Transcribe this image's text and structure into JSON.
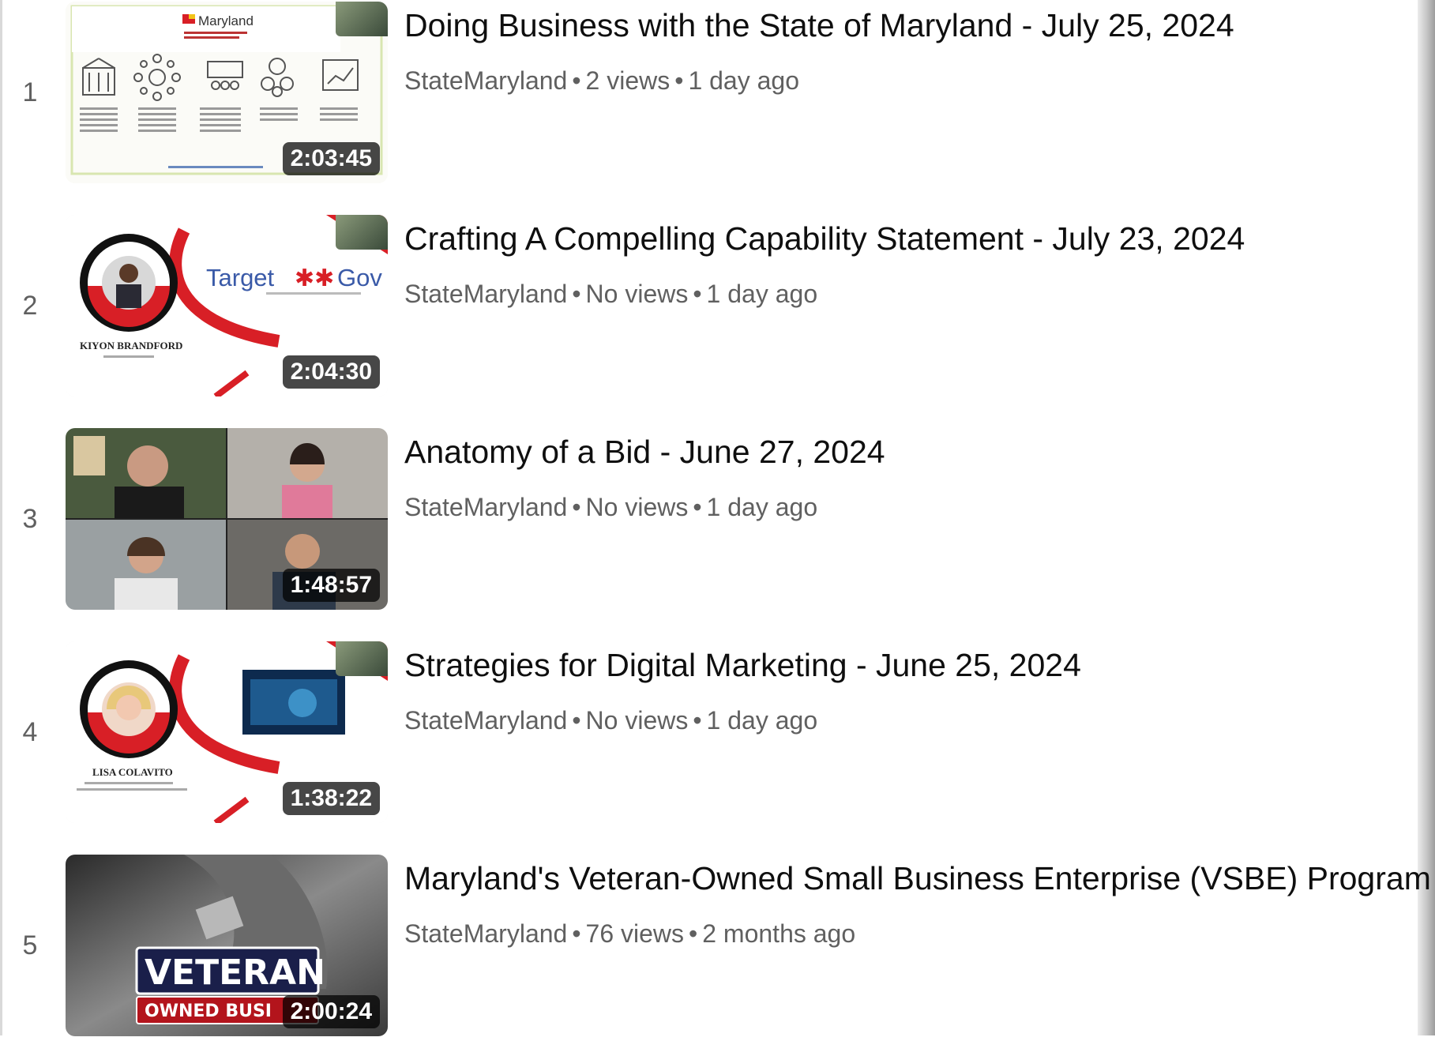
{
  "playlist": {
    "videos": [
      {
        "index": "1",
        "title": "Doing Business with the State of Maryland - July 25, 2024",
        "channel": "StateMaryland",
        "views": "2 views",
        "age": "1 day ago",
        "duration": "2:03:45",
        "thumb_logo": "Maryland"
      },
      {
        "index": "2",
        "title": "Crafting A Compelling Capability Statement - July 23, 2024",
        "channel": "StateMaryland",
        "views": "No views",
        "age": "1 day ago",
        "duration": "2:04:30",
        "thumb_logo": "Target",
        "thumb_logo_b": "Gov",
        "thumb_name": "KIYON BRANDFORD"
      },
      {
        "index": "3",
        "title": "Anatomy of a Bid - June 27, 2024",
        "channel": "StateMaryland",
        "views": "No views",
        "age": "1 day ago",
        "duration": "1:48:57"
      },
      {
        "index": "4",
        "title": "Strategies for Digital Marketing - June 25, 2024",
        "channel": "StateMaryland",
        "views": "No views",
        "age": "1 day ago",
        "duration": "1:38:22",
        "thumb_name": "LISA COLAVITO"
      },
      {
        "index": "5",
        "title": "Maryland's Veteran-Owned Small Business Enterprise (VSBE) Program",
        "channel": "StateMaryland",
        "views": "76 views",
        "age": "2 months ago",
        "duration": "2:00:24",
        "thumb_word": "VETERAN",
        "thumb_banner": "OWNED BUSI"
      }
    ]
  },
  "separator": "•",
  "colors": {
    "title": "#0f0f0f",
    "meta": "#606060",
    "accent_red": "#d81f26",
    "duration_bg": "#000000"
  },
  "icons": [
    "list-number",
    "video-thumbnail",
    "duration-badge"
  ]
}
